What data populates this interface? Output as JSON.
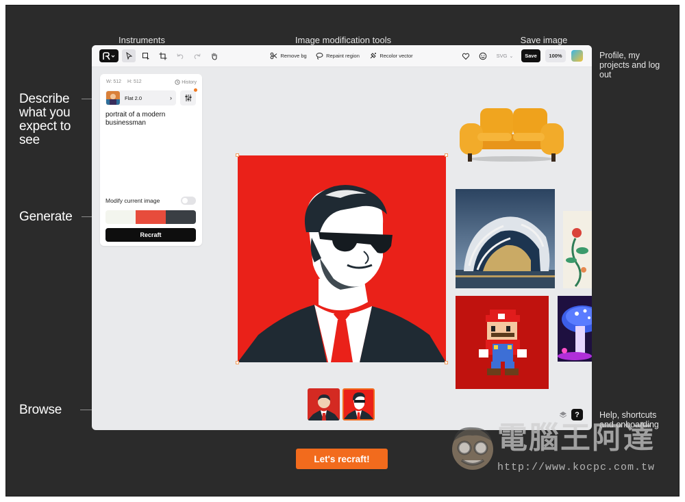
{
  "labels": {
    "instruments": "Instruments",
    "modification_tools": "Image modification tools",
    "save_image": "Save image",
    "profile": "Profile, my projects and log out",
    "describe": "Describe what you expect to see",
    "generate": "Generate",
    "browse": "Browse",
    "help": "Help, shortcuts and onboarding"
  },
  "toolbar": {
    "remove_bg": "Remove bg",
    "repaint_region": "Repaint region",
    "recolor_vector": "Recolor vector",
    "format": "SVG",
    "save": "Save",
    "zoom": "100%"
  },
  "panel": {
    "width": "W: 512",
    "height": "H: 512",
    "history": "History",
    "style": "Flat 2.0",
    "prompt": "portrait of a modern businessman",
    "modify_label": "Modify current image",
    "modify_enabled": false,
    "palette": [
      "#f3f5ee",
      "#e74c3c",
      "#3a3f44"
    ],
    "recraft": "Recraft"
  },
  "cta": "Let's recraft!",
  "watermark": {
    "title": "電腦王阿達",
    "url": "http://www.kocpc.com.tw"
  },
  "colors": {
    "accent": "#f26b1d",
    "portrait_red": "#ea2119",
    "suit": "#1f2a33"
  }
}
